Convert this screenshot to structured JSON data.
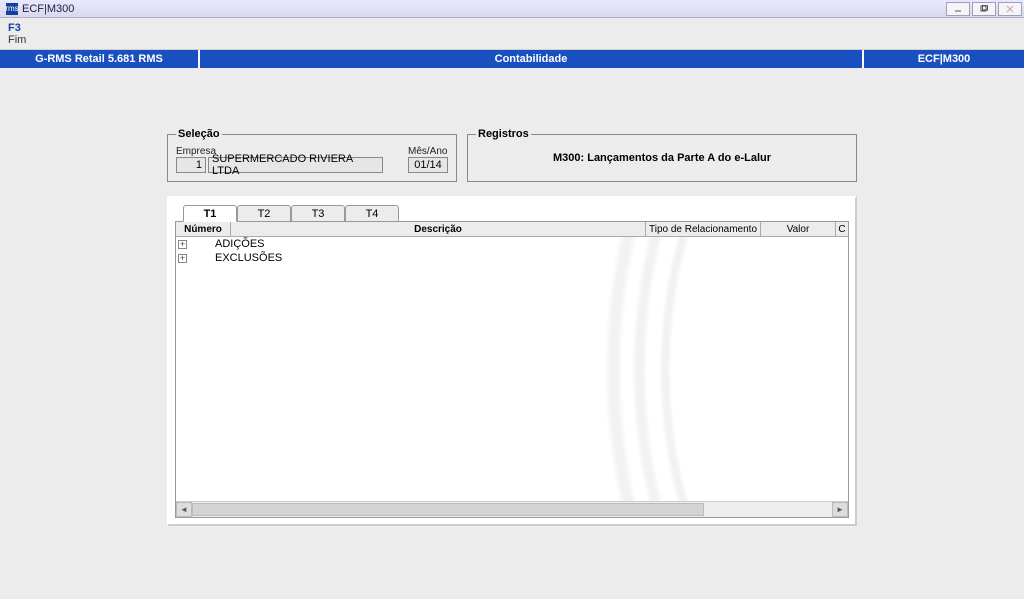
{
  "window": {
    "title": "ECF|M300",
    "app_icon_text": "rms"
  },
  "menu": {
    "f3": "F3",
    "fim": "Fim"
  },
  "bluebar": {
    "left": "G-RMS Retail 5.681 RMS",
    "center": "Contabilidade",
    "right": "ECF|M300"
  },
  "selecao": {
    "legend": "Seleção",
    "empresa_label": "Empresa",
    "empresa_num": "1",
    "empresa_nome": "SUPERMERCADO RIVIERA LTDA",
    "mesano_label": "Mês/Ano",
    "mesano": "01/14"
  },
  "registros": {
    "legend": "Registros",
    "title": "M300: Lançamentos da Parte A do e-Lalur"
  },
  "tabs": [
    "T1",
    "T2",
    "T3",
    "T4"
  ],
  "active_tab": "T1",
  "grid": {
    "columns": {
      "numero": "Número",
      "descricao": "Descrição",
      "tipo_rel": "Tipo de Relacionamento",
      "valor": "Valor",
      "last": "C"
    },
    "rows": [
      {
        "label": "ADIÇÕES"
      },
      {
        "label": "EXCLUSÕES"
      }
    ]
  }
}
